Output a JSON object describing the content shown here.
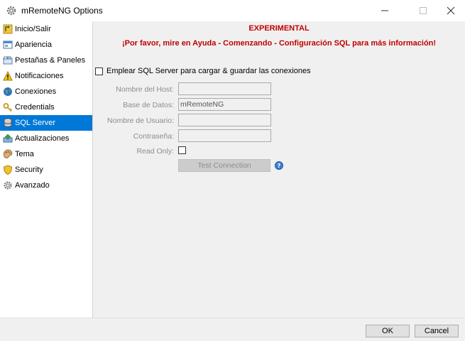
{
  "window": {
    "title": "mRemoteNG Options",
    "app_icon": "gear-icon"
  },
  "sidebar": {
    "items": [
      {
        "label": "Inicio/Salir",
        "icon": "startup-icon"
      },
      {
        "label": "Apariencia",
        "icon": "appearance-icon"
      },
      {
        "label": "Pestañas & Paneles",
        "icon": "tabs-icon"
      },
      {
        "label": "Notificaciones",
        "icon": "warning-icon"
      },
      {
        "label": "Conexiones",
        "icon": "globe-icon"
      },
      {
        "label": "Credentials",
        "icon": "key-icon"
      },
      {
        "label": "SQL Server",
        "icon": "database-icon",
        "selected": true
      },
      {
        "label": "Actualizaciones",
        "icon": "update-icon"
      },
      {
        "label": "Tema",
        "icon": "palette-icon"
      },
      {
        "label": "Security",
        "icon": "shield-icon"
      },
      {
        "label": "Avanzado",
        "icon": "gear-icon"
      }
    ],
    "selected_color": "#0078d7"
  },
  "main": {
    "experimental": "EXPERIMENTAL",
    "help_message": "¡Por favor, mire en Ayuda - Comenzando - Configuración SQL para más información!",
    "use_sql_label": "Emplear SQL Server para cargar & guardar las conexiones",
    "use_sql_checked": false,
    "fields": {
      "host_label": "Nombre del Host:",
      "host_value": "",
      "database_label": "Base de Datos:",
      "database_value": "mRemoteNG",
      "user_label": "Nombre de Usuario:",
      "user_value": "",
      "password_label": "Contraseña:",
      "password_value": "",
      "readonly_label": "Read Only:",
      "readonly_checked": false
    },
    "test_button": "Test Connection",
    "help_icon": "help-icon",
    "warning_color": "#c00000"
  },
  "footer": {
    "ok": "OK",
    "cancel": "Cancel"
  }
}
